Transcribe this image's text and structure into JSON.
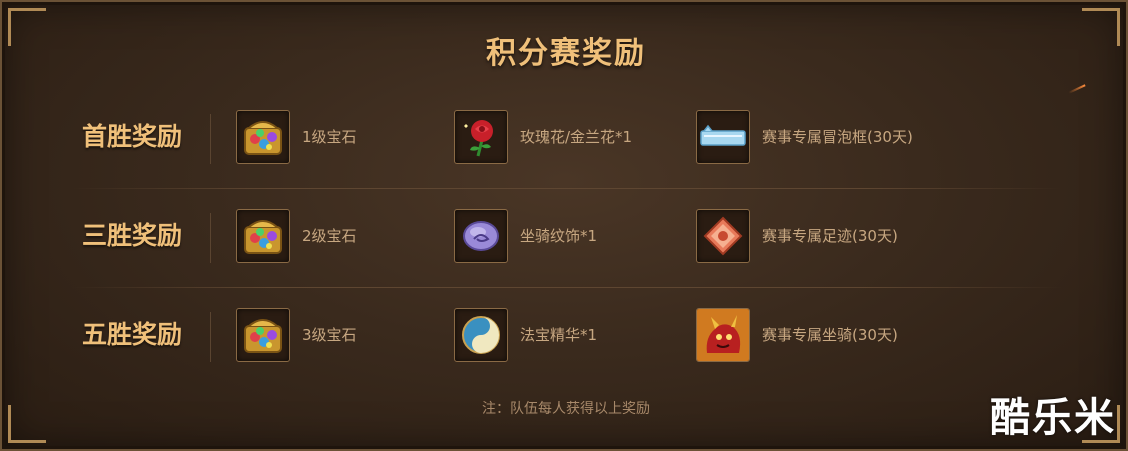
{
  "title": "积分赛奖励",
  "rows": [
    {
      "label": "首胜奖励",
      "items": [
        {
          "icon": "gem-chest-icon",
          "text": "1级宝石"
        },
        {
          "icon": "rose-icon",
          "text": "玫瑰花/金兰花*1"
        },
        {
          "icon": "bubble-frame-icon",
          "text": "赛事专属冒泡框(30天)"
        }
      ]
    },
    {
      "label": "三胜奖励",
      "items": [
        {
          "icon": "gem-chest-icon",
          "text": "2级宝石"
        },
        {
          "icon": "mount-pattern-icon",
          "text": "坐骑纹饰*1"
        },
        {
          "icon": "footprint-icon",
          "text": "赛事专属足迹(30天)"
        }
      ]
    },
    {
      "label": "五胜奖励",
      "items": [
        {
          "icon": "gem-chest-icon",
          "text": "3级宝石"
        },
        {
          "icon": "yin-yang-icon",
          "text": "法宝精华*1"
        },
        {
          "icon": "mount-icon",
          "text": "赛事专属坐骑(30天)"
        }
      ]
    }
  ],
  "note": "注：队伍每人获得以上奖励",
  "watermark": "酷乐米",
  "colors": {
    "title": "#f0c07a",
    "text": "#c7a781",
    "border": "#8a6a45",
    "background": "#3a2a1d"
  }
}
